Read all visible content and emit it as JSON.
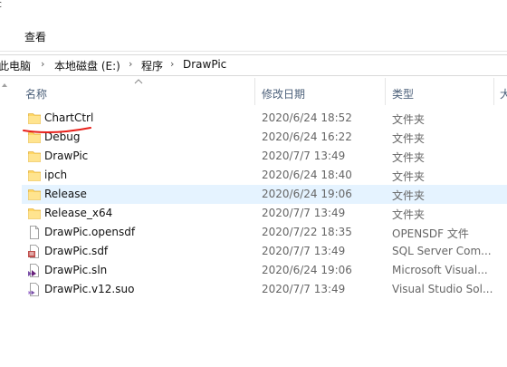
{
  "window": {
    "title_fragment": "c"
  },
  "ribbon": {
    "view_tab": "查看"
  },
  "breadcrumb": [
    "此电脑",
    "本地磁盘 (E:)",
    "程序",
    "DrawPic"
  ],
  "columns": {
    "name": "名称",
    "date": "修改日期",
    "type": "类型",
    "size": "大"
  },
  "files": [
    {
      "name": "ChartCtrl",
      "date": "2020/6/24 18:52",
      "type": "文件夹",
      "icon": "folder-icon"
    },
    {
      "name": "Debug",
      "date": "2020/6/24 16:22",
      "type": "文件夹",
      "icon": "folder-icon"
    },
    {
      "name": "DrawPic",
      "date": "2020/7/7 13:49",
      "type": "文件夹",
      "icon": "folder-icon"
    },
    {
      "name": "ipch",
      "date": "2020/6/24 18:40",
      "type": "文件夹",
      "icon": "folder-icon"
    },
    {
      "name": "Release",
      "date": "2020/6/24 19:06",
      "type": "文件夹",
      "icon": "folder-icon",
      "selected": true
    },
    {
      "name": "Release_x64",
      "date": "2020/7/7 13:49",
      "type": "文件夹",
      "icon": "folder-icon"
    },
    {
      "name": "DrawPic.opensdf",
      "date": "2020/7/22 18:35",
      "type": "OPENSDF 文件",
      "icon": "file-icon"
    },
    {
      "name": "DrawPic.sdf",
      "date": "2020/7/7 13:49",
      "type": "SQL Server Com...",
      "icon": "sql-file-icon"
    },
    {
      "name": "DrawPic.sln",
      "date": "2020/6/24 19:06",
      "type": "Microsoft Visual...",
      "icon": "solution-file-icon"
    },
    {
      "name": "DrawPic.v12.suo",
      "date": "2020/7/7 13:49",
      "type": "Visual Studio Sol...",
      "icon": "suo-file-icon"
    }
  ],
  "colors": {
    "selection": "#e5f3ff",
    "folder": "#ffd766",
    "annotation": "#e8201a",
    "header_text": "#4c607a"
  }
}
